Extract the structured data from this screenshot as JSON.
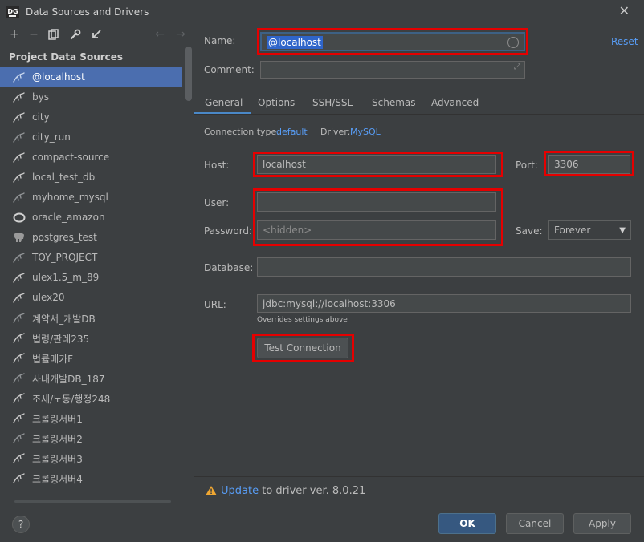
{
  "window": {
    "title": "Data Sources and Drivers",
    "app_icon": "DG"
  },
  "sidebar": {
    "section_title": "Project Data Sources",
    "toolbar": [
      {
        "icon": "plus-icon",
        "glyph": "+"
      },
      {
        "icon": "minus-icon",
        "glyph": "−"
      },
      {
        "icon": "copy-icon",
        "glyph": "⧉"
      },
      {
        "icon": "wrench-icon",
        "glyph": "🔧"
      },
      {
        "icon": "import-icon",
        "glyph": "↙"
      },
      {
        "icon": "back-arrow-icon",
        "glyph": "←"
      },
      {
        "icon": "forward-arrow-icon",
        "glyph": "→"
      }
    ],
    "items": [
      {
        "label": "@localhost",
        "icon": "mysql-dolphin-icon",
        "selected": true
      },
      {
        "label": "bys",
        "icon": "mysql-dolphin-icon"
      },
      {
        "label": "city",
        "icon": "mysql-dolphin-icon"
      },
      {
        "label": "city_run",
        "icon": "mysql-dolphin-icon"
      },
      {
        "label": "compact-source",
        "icon": "mysql-dolphin-icon"
      },
      {
        "label": "local_test_db",
        "icon": "mysql-dolphin-icon"
      },
      {
        "label": "myhome_mysql",
        "icon": "mysql-dolphin-icon"
      },
      {
        "label": "oracle_amazon",
        "icon": "oracle-icon"
      },
      {
        "label": "postgres_test",
        "icon": "postgres-elephant-icon"
      },
      {
        "label": "TOY_PROJECT",
        "icon": "mysql-dolphin-icon"
      },
      {
        "label": "ulex1.5_m_89",
        "icon": "mysql-dolphin-icon"
      },
      {
        "label": "ulex20",
        "icon": "mysql-dolphin-icon"
      },
      {
        "label": "계약서_개발DB",
        "icon": "mysql-dolphin-icon"
      },
      {
        "label": "법령/판례235",
        "icon": "mysql-dolphin-icon"
      },
      {
        "label": "법률메카F",
        "icon": "mysql-dolphin-icon"
      },
      {
        "label": "사내개발DB_187",
        "icon": "mysql-dolphin-icon"
      },
      {
        "label": "조세/노동/행정248",
        "icon": "mysql-dolphin-icon"
      },
      {
        "label": "크롤링서버1",
        "icon": "mysql-dolphin-icon"
      },
      {
        "label": "크롤링서버2",
        "icon": "mysql-dolphin-icon"
      },
      {
        "label": "크롤링서버3",
        "icon": "mysql-dolphin-icon"
      },
      {
        "label": "크롤링서버4",
        "icon": "mysql-dolphin-icon"
      }
    ]
  },
  "form": {
    "name_label": "Name:",
    "name_value": "@localhost",
    "reset": "Reset",
    "comment_label": "Comment:",
    "comment_value": "",
    "tabs": [
      "General",
      "Options",
      "SSH/SSL",
      "Schemas",
      "Advanced"
    ],
    "active_tab": "General",
    "conn_type_label": "Connection type:",
    "conn_type_value": "default",
    "driver_label": "Driver:",
    "driver_value": "MySQL",
    "host_label": "Host:",
    "host_value": "localhost",
    "port_label": "Port:",
    "port_value": "3306",
    "user_label": "User:",
    "user_value": "",
    "password_label": "Password:",
    "password_placeholder": "<hidden>",
    "save_label": "Save:",
    "save_value": "Forever",
    "database_label": "Database:",
    "database_value": "",
    "url_label": "URL:",
    "url_value": "jdbc:mysql://localhost:3306",
    "url_hint": "Overrides settings above",
    "test_connection": "Test Connection"
  },
  "warning": {
    "link": "Update",
    "text": " to driver ver. 8.0.21"
  },
  "footer": {
    "help": "?",
    "ok": "OK",
    "cancel": "Cancel",
    "apply": "Apply"
  },
  "colors": {
    "background": "#3c3f41",
    "selection": "#4b6eaf",
    "link": "#589df6",
    "highlight_box": "#e50000",
    "primary_button": "#365880",
    "warning": "#f0a732"
  }
}
